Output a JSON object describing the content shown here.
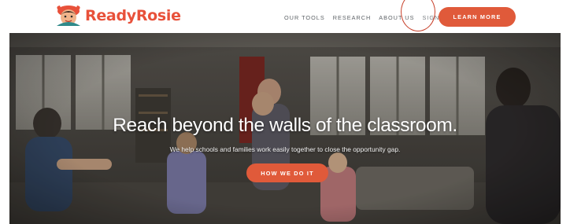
{
  "brand": {
    "name": "ReadyRosie",
    "accent_color": "#e05a3a",
    "logo_icon": "readyrosie-mascot-icon"
  },
  "nav": {
    "items": [
      {
        "label": "OUR TOOLS"
      },
      {
        "label": "RESEARCH"
      },
      {
        "label": "ABOUT US"
      },
      {
        "label": "SIGN IN"
      }
    ],
    "cta_label": "LEARN MORE"
  },
  "hero": {
    "title": "Reach beyond the walls of the classroom.",
    "subtitle": "We help schools and families work easily together to close the opportunity gap.",
    "cta_label": "HOW WE DO IT",
    "background": "classroom-photo"
  }
}
